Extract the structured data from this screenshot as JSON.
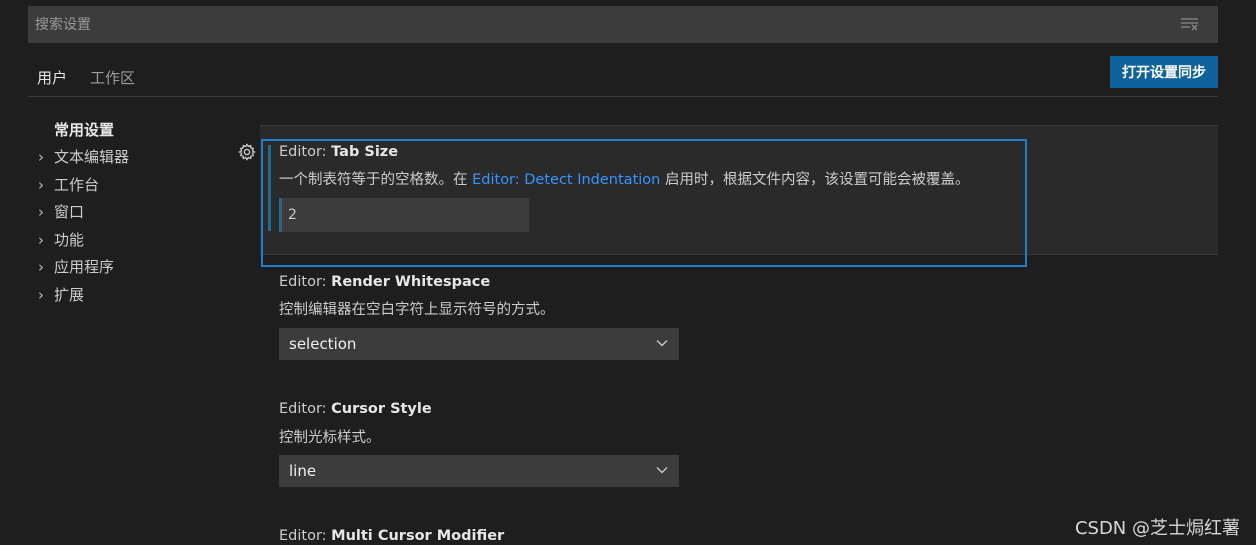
{
  "search": {
    "placeholder": "搜索设置"
  },
  "tabs": [
    {
      "label": "用户"
    },
    {
      "label": "工作区"
    }
  ],
  "sync_button": "打开设置同步",
  "toc": {
    "heading": "常用设置",
    "items": [
      {
        "label": "文本编辑器"
      },
      {
        "label": "工作台"
      },
      {
        "label": "窗口"
      },
      {
        "label": "功能"
      },
      {
        "label": "应用程序"
      },
      {
        "label": "扩展"
      }
    ]
  },
  "settings": [
    {
      "category": "Editor: ",
      "name": "Tab Size",
      "desc_before": "一个制表符等于的空格数。在 ",
      "desc_link": "Editor: Detect Indentation",
      "desc_after": " 启用时，根据文件内容，该设置可能会被覆盖。",
      "value": "2"
    },
    {
      "category": "Editor: ",
      "name": "Render Whitespace",
      "desc": "控制编辑器在空白字符上显示符号的方式。",
      "value": "selection"
    },
    {
      "category": "Editor: ",
      "name": "Cursor Style",
      "desc": "控制光标样式。",
      "value": "line"
    },
    {
      "category": "Editor: ",
      "name": "Multi Cursor Modifier"
    }
  ],
  "watermark": "CSDN @芝士焗红薯",
  "colors": {
    "accent": "#0e639c",
    "focus_border": "#1f7ec9",
    "link": "#3794ff",
    "background": "#1e1e1e"
  }
}
